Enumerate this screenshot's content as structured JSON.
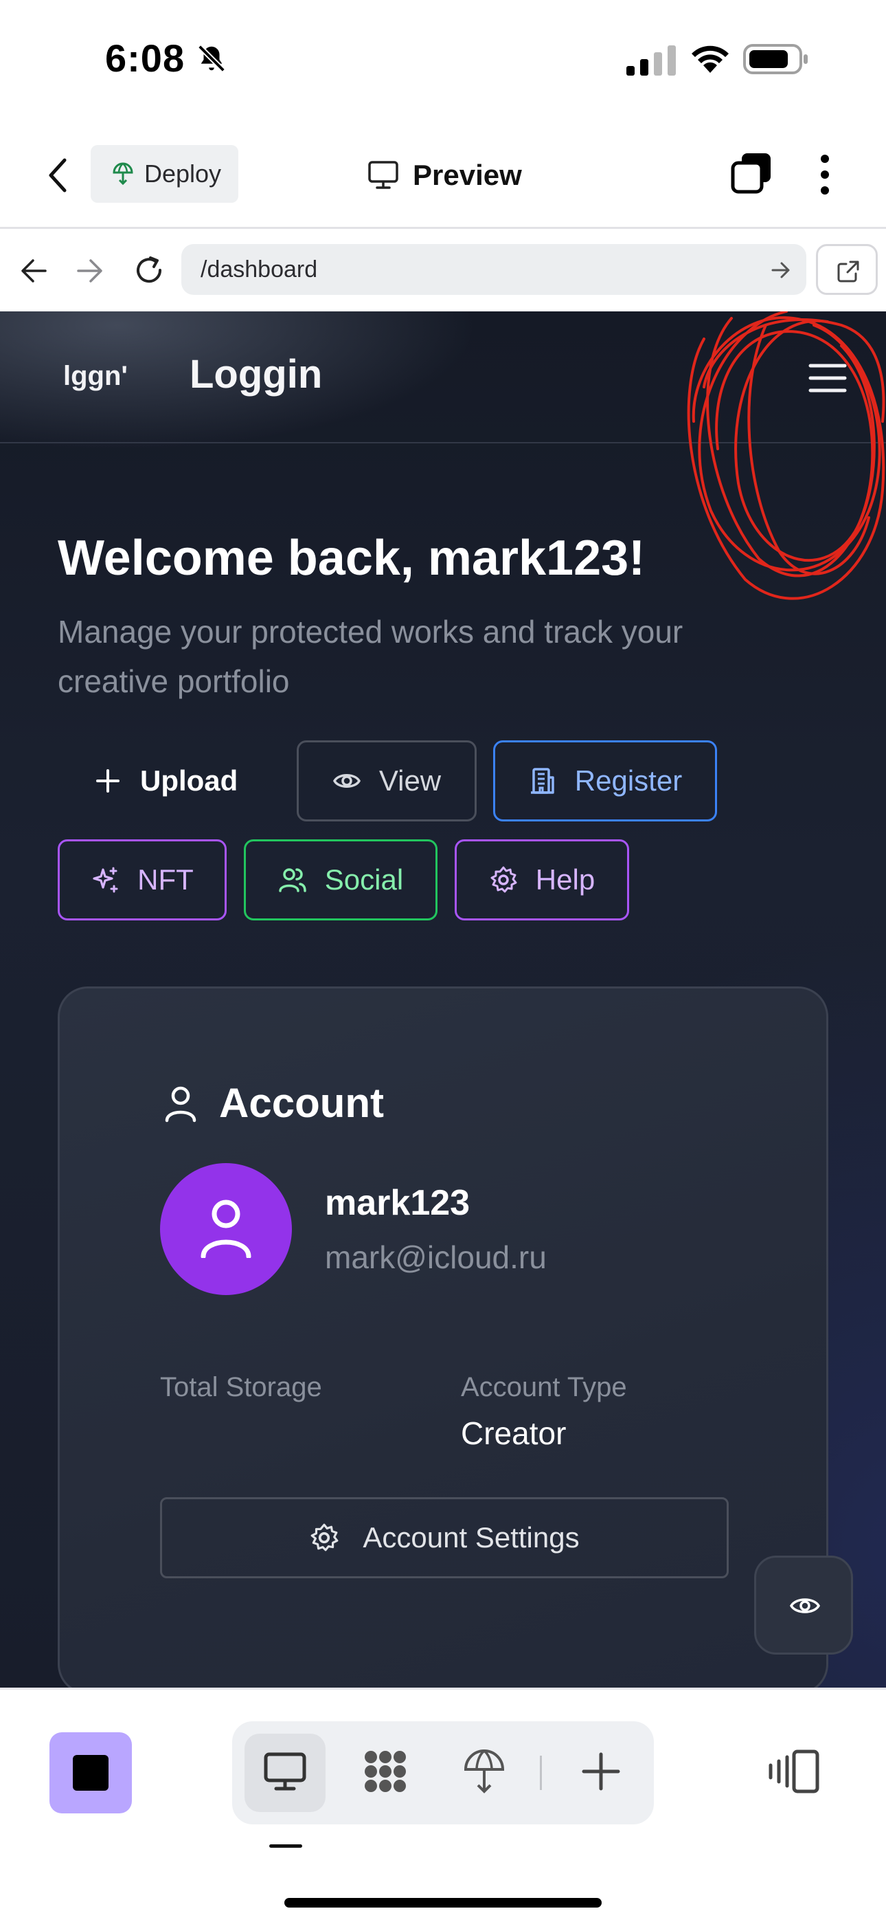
{
  "status_bar": {
    "time": "6:08"
  },
  "app_bar": {
    "deploy_label": "Deploy",
    "title": "Preview"
  },
  "browser": {
    "url": "/dashboard"
  },
  "site": {
    "logo_mark": "lggn'",
    "logo_text": "Loggin"
  },
  "dashboard": {
    "welcome": "Welcome back, mark123!",
    "subtitle": "Manage your protected works and track your creative portfolio",
    "actions": {
      "upload": "Upload",
      "view": "View",
      "register": "Register",
      "nft": "NFT",
      "social": "Social",
      "help": "Help"
    }
  },
  "account": {
    "title": "Account",
    "username": "mark123",
    "email": "mark@icloud.ru",
    "total_storage_label": "Total Storage",
    "account_type_label": "Account Type",
    "account_type_value": "Creator",
    "settings_button": "Account Settings"
  },
  "colors": {
    "accent_purple": "#9333ea",
    "register_blue": "#3b82f6",
    "social_green": "#22c55e",
    "nft_purple": "#a855f7",
    "stop_button": "#b9a6ff",
    "scribble_red": "#e0261b"
  },
  "icons": {
    "back": "chevron-left-icon",
    "deploy": "deploy-globe-icon",
    "preview": "monitor-icon",
    "tabs": "tabs-icon",
    "more": "more-vertical-icon",
    "hamburger": "menu-icon",
    "upload": "plus-icon",
    "view": "eye-icon",
    "register": "building-icon",
    "nft": "sparkles-icon",
    "social": "users-icon",
    "help": "gear-icon",
    "account": "user-icon",
    "settings": "gear-icon"
  }
}
